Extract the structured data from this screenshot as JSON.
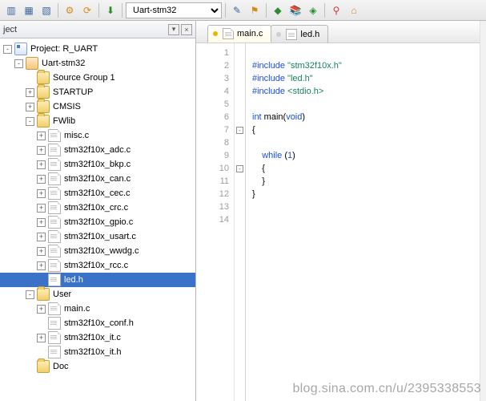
{
  "toolbar": {
    "target_dropdown": "Uart-stm32"
  },
  "project_panel": {
    "title": "ject",
    "root_label": "Project: R_UART",
    "target_label": "Uart-stm32",
    "groups": [
      {
        "label": "Source Group 1",
        "expandable": false,
        "files": []
      },
      {
        "label": "STARTUP",
        "expandable": true,
        "expanded": false,
        "files": []
      },
      {
        "label": "CMSIS",
        "expandable": true,
        "expanded": false,
        "files": []
      },
      {
        "label": "FWlib",
        "expandable": true,
        "expanded": true,
        "files": [
          {
            "label": "misc.c",
            "kind": "c",
            "expandable": true
          },
          {
            "label": "stm32f10x_adc.c",
            "kind": "c",
            "expandable": true
          },
          {
            "label": "stm32f10x_bkp.c",
            "kind": "c",
            "expandable": true
          },
          {
            "label": "stm32f10x_can.c",
            "kind": "c",
            "expandable": true
          },
          {
            "label": "stm32f10x_cec.c",
            "kind": "c",
            "expandable": true
          },
          {
            "label": "stm32f10x_crc.c",
            "kind": "c",
            "expandable": true
          },
          {
            "label": "stm32f10x_gpio.c",
            "kind": "c",
            "expandable": true
          },
          {
            "label": "stm32f10x_usart.c",
            "kind": "c",
            "expandable": true
          },
          {
            "label": "stm32f10x_wwdg.c",
            "kind": "c",
            "expandable": true
          },
          {
            "label": "stm32f10x_rcc.c",
            "kind": "c",
            "expandable": true
          },
          {
            "label": "led.h",
            "kind": "h",
            "expandable": false,
            "selected": true
          }
        ]
      },
      {
        "label": "User",
        "expandable": true,
        "expanded": true,
        "files": [
          {
            "label": "main.c",
            "kind": "c",
            "expandable": true
          },
          {
            "label": "stm32f10x_conf.h",
            "kind": "h",
            "expandable": false
          },
          {
            "label": "stm32f10x_it.c",
            "kind": "c",
            "expandable": true
          },
          {
            "label": "stm32f10x_it.h",
            "kind": "h",
            "expandable": false
          }
        ]
      },
      {
        "label": "Doc",
        "expandable": false,
        "files": []
      }
    ]
  },
  "tabs": [
    {
      "label": "main.c",
      "kind": "c",
      "active": true
    },
    {
      "label": "led.h",
      "kind": "h",
      "active": false
    }
  ],
  "editor": {
    "lines": [
      {
        "n": 1,
        "html": ""
      },
      {
        "n": 2,
        "html": "<span class='pp'>#include</span> <span class='str'>\"stm32f10x.h\"</span>"
      },
      {
        "n": 3,
        "html": "<span class='pp'>#include</span> <span class='str'>\"led.h\"</span>"
      },
      {
        "n": 4,
        "html": "<span class='pp'>#include</span> <span class='sys'>&lt;stdio.h&gt;</span>"
      },
      {
        "n": 5,
        "html": ""
      },
      {
        "n": 6,
        "html": "<span class='kw'>int</span> main(<span class='kw'>void</span>)"
      },
      {
        "n": 7,
        "html": "{",
        "fold": "-"
      },
      {
        "n": 8,
        "html": ""
      },
      {
        "n": 9,
        "html": "    <span class='kw'>while</span> (<span class='num'>1</span>)"
      },
      {
        "n": 10,
        "html": "    {",
        "fold": "-"
      },
      {
        "n": 11,
        "html": "    }"
      },
      {
        "n": 12,
        "html": "}"
      },
      {
        "n": 13,
        "html": ""
      },
      {
        "n": 14,
        "html": ""
      }
    ]
  },
  "watermark": "blog.sina.com.cn/u/2395338553"
}
